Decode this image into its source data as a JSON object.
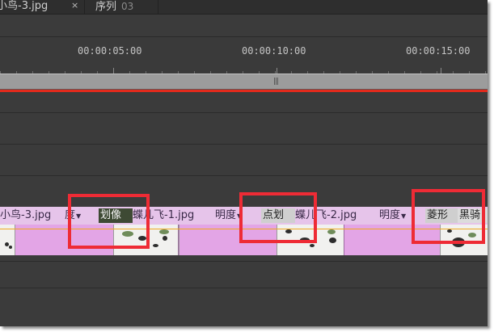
{
  "tabs": [
    {
      "label": "小鸟-3.jpg",
      "close": "×"
    },
    {
      "label": "序列",
      "sub": "03"
    }
  ],
  "ruler": {
    "timecodes": [
      "00:00:05:00",
      "00:00:10:00",
      "00:00:15:00"
    ]
  },
  "workarea": {
    "grip": "|||"
  },
  "clips": {
    "items": [
      {
        "name": "小鸟-3.jpg",
        "effect": "度"
      },
      {
        "transition": "划像"
      },
      {
        "name": "蝶儿飞-1.jpg",
        "effect": "明度"
      },
      {
        "transition": "点划"
      },
      {
        "name": "蝶儿飞-2.jpg",
        "effect": "明度"
      },
      {
        "transition": "菱形"
      },
      {
        "name": "黑骑"
      }
    ],
    "dropdown_glyph": "▼"
  },
  "colors": {
    "panel_bg": "#3b3b3b",
    "clip_header": "#e6c4ea",
    "clip_body": "#e3a5e6",
    "playhead_line": "#e32a1c",
    "annotation": "#ee2b35",
    "audio_line": "#f0a820"
  }
}
